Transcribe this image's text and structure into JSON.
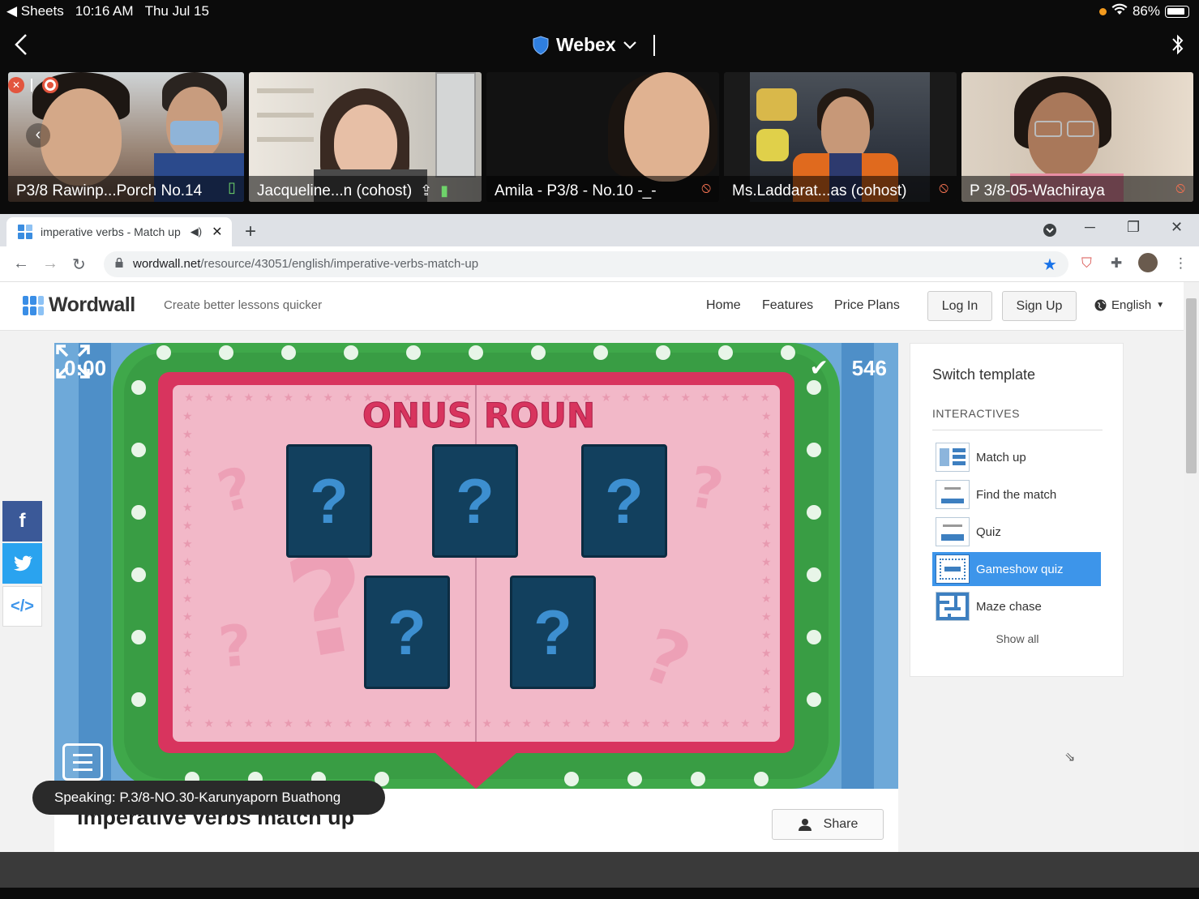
{
  "status_bar": {
    "back_app": "◀ Sheets",
    "time": "10:16 AM",
    "date": "Thu Jul 15",
    "battery": "86%"
  },
  "webex": {
    "title": "Webex"
  },
  "participants": [
    {
      "name": "P3/8 Rawinp...Porch No.14",
      "mic": "on"
    },
    {
      "name": "Jacqueline...n (cohost)",
      "mic": "on"
    },
    {
      "name": "Amila - P3/8 - No.10 -_-",
      "mic": "muted"
    },
    {
      "name": "Ms.Laddarat...as (cohost)",
      "mic": "muted"
    },
    {
      "name": "P 3/8-05-Wachiraya",
      "mic": "muted"
    }
  ],
  "browser": {
    "tab_title": "imperative verbs - Match up",
    "url_host": "wordwall.net",
    "url_path": "/resource/43051/english/imperative-verbs-match-up"
  },
  "wordwall": {
    "logo": "Wordwall",
    "tagline": "Create better lessons quicker",
    "nav": [
      "Home",
      "Features",
      "Price Plans"
    ],
    "login": "Log In",
    "signup": "Sign Up",
    "language": "English"
  },
  "game": {
    "timer": "0:00",
    "score": "546",
    "banner": "BONUS ROUND",
    "cards": [
      "?",
      "?",
      "?",
      "?",
      "?"
    ]
  },
  "activity": {
    "title": "imperative verbs match up",
    "share": "Share"
  },
  "templates": {
    "heading": "Switch template",
    "section": "INTERACTIVES",
    "items": [
      {
        "label": "Match up",
        "active": false
      },
      {
        "label": "Find the match",
        "active": false
      },
      {
        "label": "Quiz",
        "active": false
      },
      {
        "label": "Gameshow quiz",
        "active": true
      },
      {
        "label": "Maze chase",
        "active": false
      }
    ],
    "show_all": "Show all"
  },
  "speaking": "Speaking: P.3/8-NO.30-Karunyaporn Buathong",
  "colors": {
    "accent_blue": "#3d95ea",
    "facebook": "#3b5998",
    "twitter": "#1da1f2",
    "game_green": "#3fa84a",
    "game_pink": "#f2b8c8",
    "card_navy": "#12405e"
  }
}
